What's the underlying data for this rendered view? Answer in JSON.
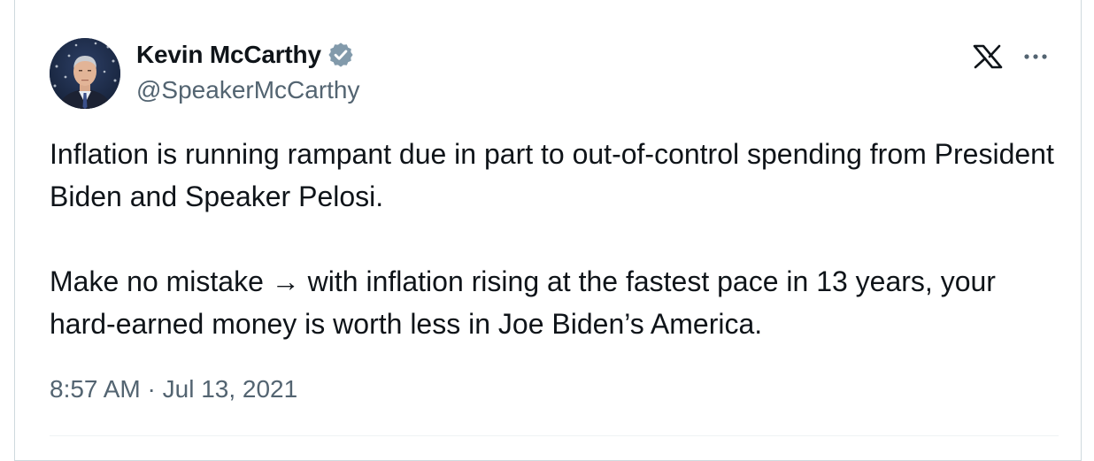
{
  "author": {
    "display_name": "Kevin McCarthy",
    "handle": "@SpeakerMcCarthy",
    "verified_icon": "verified-badge-icon",
    "avatar": "avatar-photo"
  },
  "tweet": {
    "paragraph_1": "Inflation is running rampant due in part to out-of-control spending from President Biden and Speaker Pelosi.",
    "paragraph_2": "Make no mistake → with inflation rising at the fastest pace in 13 years, your hard-earned money is worth less in Joe Biden’s America."
  },
  "meta": {
    "time": "8:57 AM",
    "separator": " · ",
    "date": "Jul 13, 2021"
  },
  "icons": {
    "logo": "x-logo-icon",
    "more": "more-options-icon"
  },
  "colors": {
    "text": "#0f1419",
    "secondary": "#536471",
    "verified": "#829aab",
    "border": "#cfd9de"
  }
}
